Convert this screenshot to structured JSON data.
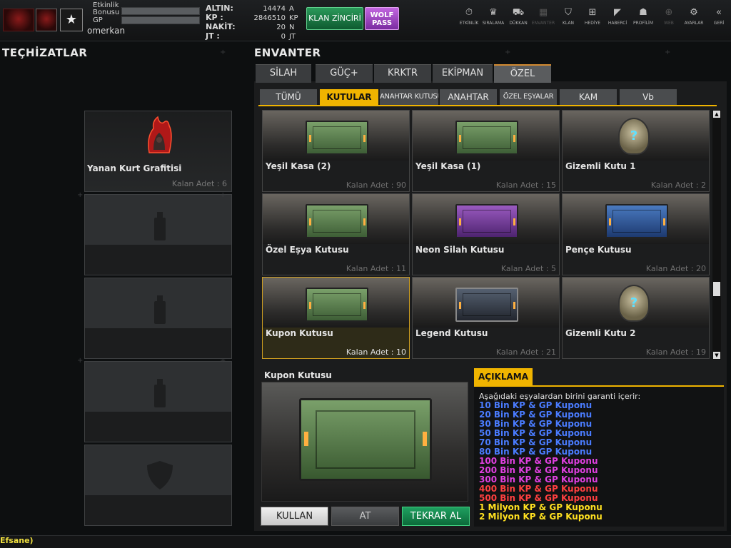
{
  "player": {
    "bonus_label": "Etkinlik Bonusu",
    "gp_label": "GP",
    "name": "omerkan"
  },
  "currency": [
    {
      "label": "ALTIN:",
      "value": "14474",
      "unit": "A"
    },
    {
      "label": "KP  :",
      "value": "2846510",
      "unit": "KP"
    },
    {
      "label": "NAKİT:",
      "value": "20",
      "unit": "N"
    },
    {
      "label": "JT  :",
      "value": "0",
      "unit": "JT"
    }
  ],
  "topbar": {
    "clan_chain": "KLAN ZİNCİRİ",
    "wolf_pass_line1": "WOLF",
    "wolf_pass_line2": "PASS",
    "nav": [
      {
        "label": "ETKİNLİK",
        "icon": "⏱",
        "name": "event-icon",
        "dim": false
      },
      {
        "label": "SIRALAMA",
        "icon": "♛",
        "name": "ranking-icon",
        "dim": false
      },
      {
        "label": "DÜKKAN",
        "icon": "⛟",
        "name": "cart-icon",
        "dim": false
      },
      {
        "label": "ENVANTER",
        "icon": "▦",
        "name": "inventory-icon",
        "dim": true
      },
      {
        "label": "KLAN",
        "icon": "⛉",
        "name": "clan-icon",
        "dim": false
      },
      {
        "label": "HEDİYE",
        "icon": "⊞",
        "name": "gift-icon",
        "dim": false
      },
      {
        "label": "HABERCİ",
        "icon": "◤",
        "name": "megaphone-icon",
        "dim": false
      },
      {
        "label": "PROFİLİM",
        "icon": "☗",
        "name": "profile-icon",
        "dim": false
      },
      {
        "label": "WEB",
        "icon": "⊕",
        "name": "web-icon",
        "dim": true
      },
      {
        "label": "AYARLAR",
        "icon": "⚙",
        "name": "gear-icon",
        "dim": false
      },
      {
        "label": "GERİ",
        "icon": "«",
        "name": "back-icon",
        "dim": false
      }
    ]
  },
  "equipment": {
    "title": "TEÇHİZATLAR",
    "slot1_name": "Yanan Kurt Grafitisi",
    "slot1_count": "Kalan Adet : 6"
  },
  "inventory": {
    "title": "ENVANTER",
    "main_tabs": [
      "SİLAH",
      "GÜÇ+",
      "KRKTR",
      "EKİPMAN",
      "ÖZEL"
    ],
    "sub_tabs": [
      "TÜMÜ",
      "KUTULAR",
      "ANAHTAR KUTUSU",
      "ANAHTAR",
      "ÖZEL EŞYALAR",
      "KAM",
      "Vb"
    ],
    "items": [
      {
        "name": "Yeşil Kasa (2)",
        "count": "Kalan Adet : 90",
        "art": "green"
      },
      {
        "name": "Yeşil Kasa (1)",
        "count": "Kalan Adet : 15",
        "art": "green"
      },
      {
        "name": "Gizemli Kutu 1",
        "count": "Kalan Adet : 2",
        "art": "mystery"
      },
      {
        "name": "Özel Eşya Kutusu",
        "count": "Kalan Adet : 11",
        "art": "green"
      },
      {
        "name": "Neon Silah Kutusu",
        "count": "Kalan Adet : 5",
        "art": "purple"
      },
      {
        "name": "Pençe Kutusu",
        "count": "Kalan Adet : 20",
        "art": "blue"
      },
      {
        "name": "Kupon Kutusu",
        "count": "Kalan Adet : 10",
        "art": "green"
      },
      {
        "name": "Legend Kutusu",
        "count": "Kalan Adet : 21",
        "art": "steel"
      },
      {
        "name": "Gizemli Kutu 2",
        "count": "Kalan Adet : 19",
        "art": "mystery"
      }
    ]
  },
  "detail": {
    "name": "Kupon Kutusu",
    "use": "KULLAN",
    "drop": "AT",
    "rebuy": "TEKRAR AL",
    "desc_tab": "AÇIKLAMA",
    "desc_intro": "Aşağıdaki eşyalardan birini garanti içerir:",
    "desc_lines": [
      {
        "text": "10 Bin KP & GP Kuponu",
        "color": "#4a7cff"
      },
      {
        "text": "20 Bin KP & GP Kuponu",
        "color": "#4a7cff"
      },
      {
        "text": "30 Bin KP & GP Kuponu",
        "color": "#4a7cff"
      },
      {
        "text": "50 Bin KP & GP Kuponu",
        "color": "#4a7cff"
      },
      {
        "text": "70 Bin KP & GP Kuponu",
        "color": "#4a7cff"
      },
      {
        "text": "80 Bin KP & GP Kuponu",
        "color": "#4a7cff"
      },
      {
        "text": "100 Bin KP & GP Kuponu",
        "color": "#e040e0"
      },
      {
        "text": "200 Bin KP & GP Kuponu",
        "color": "#e040e0"
      },
      {
        "text": "300 Bin KP & GP Kuponu",
        "color": "#e040e0"
      },
      {
        "text": "400 Bin KP & GP Kuponu",
        "color": "#ff4040"
      },
      {
        "text": "500 Bin KP & GP Kuponu",
        "color": "#ff4040"
      },
      {
        "text": "1 Milyon KP & GP Kuponu",
        "color": "#ffe020"
      },
      {
        "text": "2 Milyon KP & GP Kuponu",
        "color": "#ffe020"
      }
    ]
  },
  "chat": "Efsane)",
  "colors": {
    "accent": "#f0b400",
    "green_button": "#1fa060",
    "purple_button": "#a648d0"
  }
}
